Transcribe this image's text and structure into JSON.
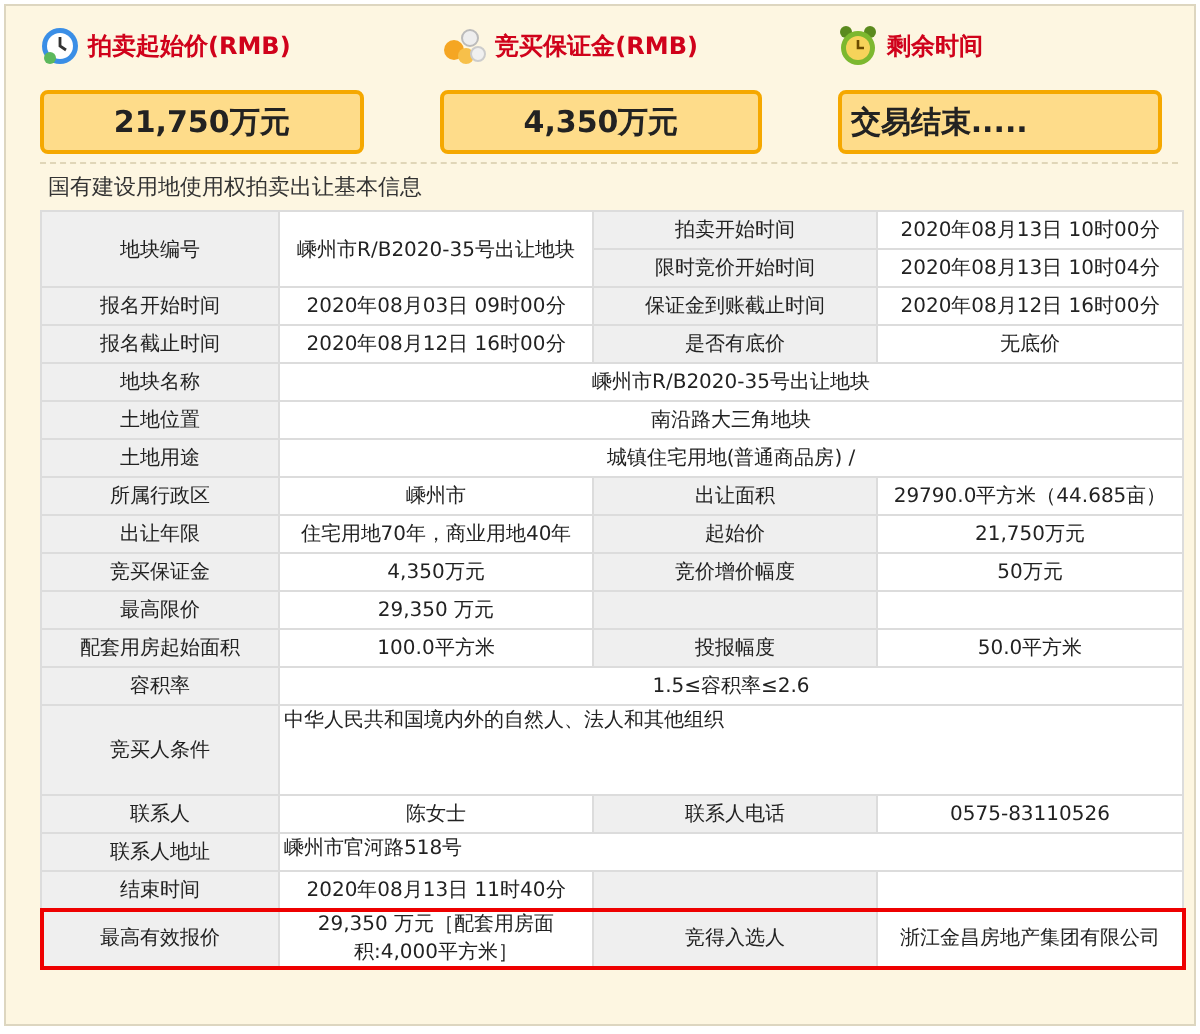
{
  "summary": [
    {
      "kind": "price",
      "title": "拍卖起始价(RMB)",
      "value": "21,750万元"
    },
    {
      "kind": "deposit",
      "title": "竞买保证金(RMB)",
      "value": "4,350万元"
    },
    {
      "kind": "timer",
      "title": "剩余时间",
      "value": "交易结束....."
    }
  ],
  "section_title": "国有建设用地使用权拍卖出让基本信息",
  "table": {
    "rows": [
      {
        "highlighted": false,
        "cells": [
          {
            "kind": "label",
            "text": "地块编号",
            "rowspan": 2
          },
          {
            "kind": "value",
            "text": "嵊州市R/B2020-35号出让地块",
            "rowspan": 2
          },
          {
            "kind": "label",
            "text": "拍卖开始时间"
          },
          {
            "kind": "value",
            "text": "2020年08月13日 10时00分"
          }
        ]
      },
      {
        "highlighted": false,
        "cells": [
          {
            "kind": "label",
            "text": "限时竞价开始时间"
          },
          {
            "kind": "value",
            "text": "2020年08月13日 10时04分"
          }
        ]
      },
      {
        "highlighted": false,
        "cells": [
          {
            "kind": "label",
            "text": "报名开始时间"
          },
          {
            "kind": "value",
            "text": "2020年08月03日 09时00分"
          },
          {
            "kind": "label",
            "text": "保证金到账截止时间"
          },
          {
            "kind": "value",
            "text": "2020年08月12日 16时00分"
          }
        ]
      },
      {
        "highlighted": false,
        "cells": [
          {
            "kind": "label",
            "text": "报名截止时间"
          },
          {
            "kind": "value",
            "text": "2020年08月12日 16时00分"
          },
          {
            "kind": "label",
            "text": "是否有底价"
          },
          {
            "kind": "value",
            "text": "无底价"
          }
        ]
      },
      {
        "highlighted": false,
        "cells": [
          {
            "kind": "label",
            "text": "地块名称"
          },
          {
            "kind": "value",
            "text": "嵊州市R/B2020-35号出让地块",
            "colspan": 3
          }
        ]
      },
      {
        "highlighted": false,
        "cells": [
          {
            "kind": "label",
            "text": "土地位置"
          },
          {
            "kind": "value",
            "text": "南沿路大三角地块",
            "colspan": 3
          }
        ]
      },
      {
        "highlighted": false,
        "cells": [
          {
            "kind": "label",
            "text": "土地用途"
          },
          {
            "kind": "value",
            "text": "城镇住宅用地(普通商品房) /",
            "colspan": 3
          }
        ]
      },
      {
        "highlighted": false,
        "cells": [
          {
            "kind": "label",
            "text": "所属行政区"
          },
          {
            "kind": "value",
            "text": "嵊州市"
          },
          {
            "kind": "label",
            "text": "出让面积"
          },
          {
            "kind": "value",
            "text": "29790.0平方米（44.685亩）"
          }
        ]
      },
      {
        "highlighted": false,
        "cells": [
          {
            "kind": "label",
            "text": "出让年限"
          },
          {
            "kind": "value",
            "text": "住宅用地70年，商业用地40年"
          },
          {
            "kind": "label",
            "text": "起始价"
          },
          {
            "kind": "value",
            "text": "21,750万元"
          }
        ]
      },
      {
        "highlighted": false,
        "cells": [
          {
            "kind": "label",
            "text": "竞买保证金"
          },
          {
            "kind": "value",
            "text": "4,350万元"
          },
          {
            "kind": "label",
            "text": "竞价增价幅度"
          },
          {
            "kind": "value",
            "text": "50万元"
          }
        ]
      },
      {
        "highlighted": false,
        "cells": [
          {
            "kind": "label",
            "text": "最高限价"
          },
          {
            "kind": "value",
            "text": "29,350 万元"
          },
          {
            "kind": "label"
          },
          {
            "kind": "value"
          }
        ]
      },
      {
        "highlighted": false,
        "cells": [
          {
            "kind": "label",
            "text": "配套用房起始面积"
          },
          {
            "kind": "value",
            "text": "100.0平方米"
          },
          {
            "kind": "label",
            "text": "投报幅度"
          },
          {
            "kind": "value",
            "text": "50.0平方米"
          }
        ]
      },
      {
        "highlighted": false,
        "cells": [
          {
            "kind": "label",
            "text": "容积率"
          },
          {
            "kind": "value",
            "text": "1.5≤容积率≤2.6",
            "colspan": 3
          }
        ]
      },
      {
        "highlighted": false,
        "cells": [
          {
            "kind": "label",
            "text": "竞买人条件"
          },
          {
            "kind": "note",
            "text": "中华人民共和国境内外的自然人、法人和其他组织",
            "colspan": 3
          }
        ]
      },
      {
        "highlighted": false,
        "cells": [
          {
            "kind": "label",
            "text": "联系人"
          },
          {
            "kind": "value",
            "text": "陈女士"
          },
          {
            "kind": "label",
            "text": "联系人电话"
          },
          {
            "kind": "value",
            "text": "0575-83110526"
          }
        ]
      },
      {
        "highlighted": false,
        "cells": [
          {
            "kind": "label",
            "text": "联系人地址"
          },
          {
            "kind": "note",
            "text": "嵊州市官河路518号",
            "colspan": 3
          }
        ]
      },
      {
        "highlighted": false,
        "cells": [
          {
            "kind": "label",
            "text": "结束时间"
          },
          {
            "kind": "value",
            "text": "2020年08月13日 11时40分"
          },
          {
            "kind": "label"
          },
          {
            "kind": "value"
          }
        ]
      },
      {
        "highlighted": true,
        "cells": [
          {
            "kind": "label",
            "text": "最高有效报价"
          },
          {
            "kind": "value",
            "text": "29,350 万元［配套用房面积:4,000平方米］"
          },
          {
            "kind": "label",
            "text": "竞得入选人"
          },
          {
            "kind": "value",
            "text": "浙江金昌房地产集团有限公司"
          }
        ]
      }
    ]
  }
}
